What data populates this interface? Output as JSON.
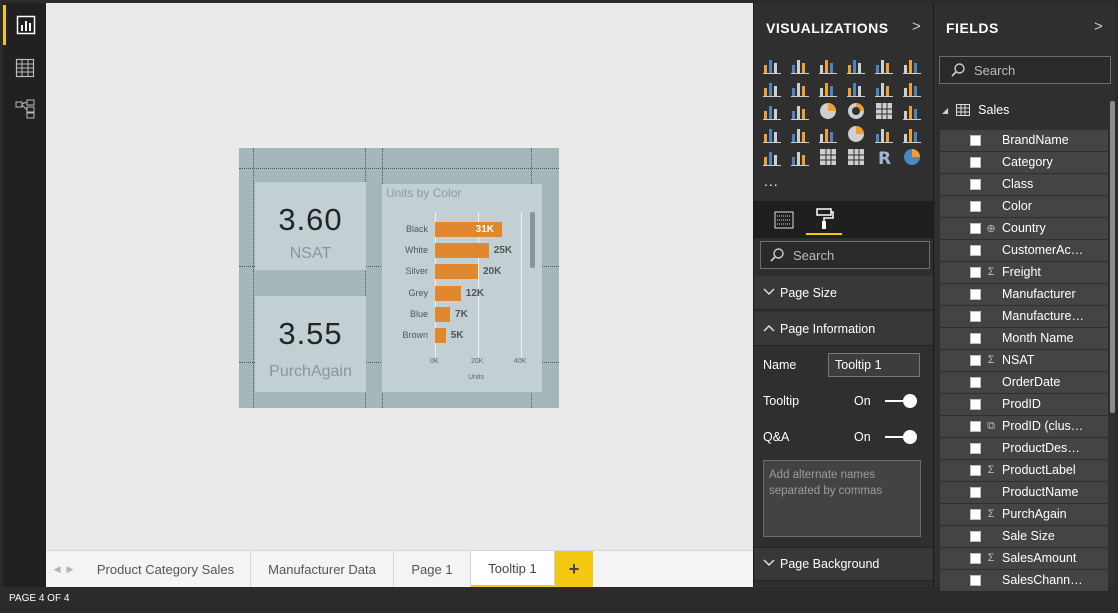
{
  "left_rail": {
    "items": [
      {
        "icon": "report-view-icon",
        "active": true
      },
      {
        "icon": "data-view-icon",
        "active": false
      },
      {
        "icon": "relationships-view-icon",
        "active": false
      }
    ]
  },
  "report_page": {
    "card1": {
      "value": "3.60",
      "label": "NSAT"
    },
    "card2": {
      "value": "3.55",
      "label": "PurchAgain"
    },
    "bar_chart": {
      "title": "Units by Color",
      "categories": [
        "Black",
        "White",
        "Silver",
        "Grey",
        "Blue",
        "Brown"
      ],
      "value_labels": [
        "31K",
        "25K",
        "20K",
        "12K",
        "7K",
        "5K"
      ],
      "x_ticks": [
        "0K",
        "20K",
        "40K"
      ],
      "xlabel": "Units"
    }
  },
  "chart_data": {
    "type": "bar",
    "title": "Units by Color",
    "categories": [
      "Black",
      "White",
      "Silver",
      "Grey",
      "Blue",
      "Brown"
    ],
    "values": [
      31000,
      25000,
      20000,
      12000,
      7000,
      5000
    ],
    "xlabel": "Units",
    "xlim": [
      0,
      40000
    ],
    "orientation": "horizontal",
    "bar_color": "#e1872d",
    "legend": "none"
  },
  "page_tabs": {
    "tabs": [
      "Product Category Sales",
      "Manufacturer Data",
      "Page 1",
      "Tooltip 1"
    ],
    "active": "Tooltip 1",
    "add_label": "+"
  },
  "status_bar": {
    "text": "PAGE 4 OF 4"
  },
  "visualizations": {
    "title": "VISUALIZATIONS",
    "expand_glyph": ">",
    "more_glyph": "...",
    "search_placeholder": "Search",
    "sections": {
      "page_size": "Page Size",
      "page_information": "Page Information",
      "page_background": "Page Background"
    },
    "name_label": "Name",
    "name_value": "Tooltip 1",
    "tooltip_label": "Tooltip",
    "tooltip_state": "On",
    "qa_label": "Q&A",
    "qa_state": "On",
    "qa_placeholder": "Add alternate names separated by commas"
  },
  "fields": {
    "title": "FIELDS",
    "expand_glyph": ">",
    "search_placeholder": "Search",
    "table_name": "Sales",
    "items": [
      {
        "name": "BrandName",
        "type": "text"
      },
      {
        "name": "Category",
        "type": "text"
      },
      {
        "name": "Class",
        "type": "text"
      },
      {
        "name": "Color",
        "type": "text"
      },
      {
        "name": "Country",
        "type": "geo"
      },
      {
        "name": "CustomerAcc...",
        "type": "text"
      },
      {
        "name": "Freight",
        "type": "sum"
      },
      {
        "name": "Manufacturer",
        "type": "text"
      },
      {
        "name": "Manufacturer ...",
        "type": "text"
      },
      {
        "name": "Month Name",
        "type": "text"
      },
      {
        "name": "NSAT",
        "type": "sum"
      },
      {
        "name": "OrderDate",
        "type": "text"
      },
      {
        "name": "ProdID",
        "type": "text"
      },
      {
        "name": "ProdID (cluste...",
        "type": "cluster"
      },
      {
        "name": "ProductDescri...",
        "type": "text"
      },
      {
        "name": "ProductLabel",
        "type": "sum"
      },
      {
        "name": "ProductName",
        "type": "text"
      },
      {
        "name": "PurchAgain",
        "type": "sum"
      },
      {
        "name": "Sale Size",
        "type": "text"
      },
      {
        "name": "SalesAmount",
        "type": "sum"
      },
      {
        "name": "SalesChannel...",
        "type": "text"
      }
    ]
  },
  "colors": {
    "accent": "#f2c811",
    "bar": "#e1872d",
    "pane_bg": "#2f2f2f",
    "page_bg": "#a5b6bb",
    "card_bg": "#c2cfd3"
  }
}
